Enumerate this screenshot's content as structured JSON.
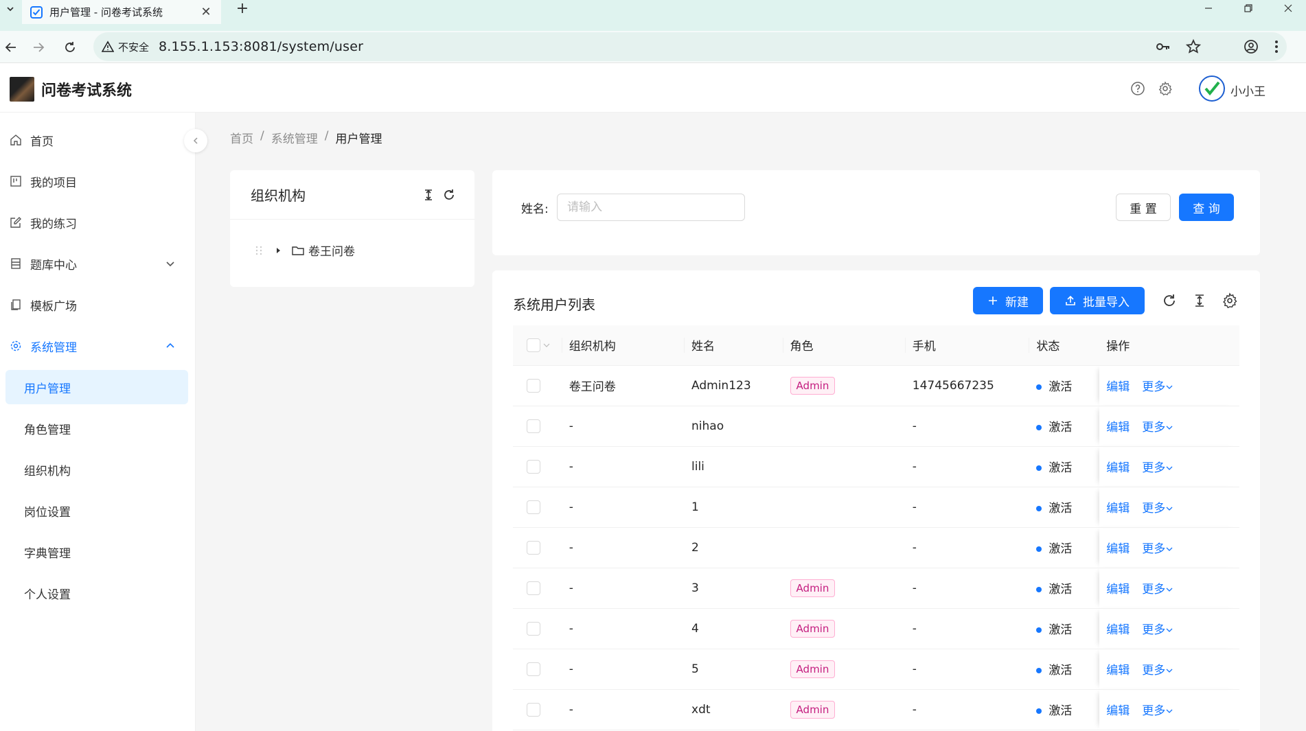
{
  "browser": {
    "tab_title": "用户管理 - 问卷考试系统",
    "security_label": "不安全",
    "url": "8.155.1.153:8081/system/user"
  },
  "header": {
    "app_title": "问卷考试系统",
    "username": "小小王"
  },
  "sidebar": {
    "items": [
      {
        "label": "首页",
        "icon": "home-icon"
      },
      {
        "label": "我的项目",
        "icon": "project-icon"
      },
      {
        "label": "我的练习",
        "icon": "edit-icon"
      },
      {
        "label": "题库中心",
        "icon": "database-icon"
      },
      {
        "label": "模板广场",
        "icon": "copy-icon"
      },
      {
        "label": "系统管理",
        "icon": "gear-icon"
      }
    ],
    "sub_items": [
      {
        "label": "用户管理"
      },
      {
        "label": "角色管理"
      },
      {
        "label": "组织机构"
      },
      {
        "label": "岗位设置"
      },
      {
        "label": "字典管理"
      },
      {
        "label": "个人设置"
      }
    ]
  },
  "breadcrumb": {
    "home": "首页",
    "sep": "/",
    "parent": "系统管理",
    "current": "用户管理"
  },
  "org_panel": {
    "title": "组织机构",
    "node": "卷王问卷"
  },
  "search": {
    "name_label": "姓名:",
    "name_placeholder": "请输入",
    "reset_label": "重 置",
    "query_label": "查 询"
  },
  "list": {
    "title": "系统用户列表",
    "new_label": "新建",
    "import_label": "批量导入",
    "columns": [
      "组织机构",
      "姓名",
      "角色",
      "手机",
      "状态",
      "操作"
    ],
    "edit_label": "编辑",
    "more_label": "更多",
    "rows": [
      {
        "org": "卷王问卷",
        "name": "Admin123",
        "role": "Admin",
        "phone": "14745667235",
        "status": "激活"
      },
      {
        "org": "-",
        "name": "nihao",
        "role": "",
        "phone": "-",
        "status": "激活"
      },
      {
        "org": "-",
        "name": "lili",
        "role": "",
        "phone": "-",
        "status": "激活"
      },
      {
        "org": "-",
        "name": "1",
        "role": "",
        "phone": "-",
        "status": "激活"
      },
      {
        "org": "-",
        "name": "2",
        "role": "",
        "phone": "-",
        "status": "激活"
      },
      {
        "org": "-",
        "name": "3",
        "role": "Admin",
        "phone": "-",
        "status": "激活"
      },
      {
        "org": "-",
        "name": "4",
        "role": "Admin",
        "phone": "-",
        "status": "激活"
      },
      {
        "org": "-",
        "name": "5",
        "role": "Admin",
        "phone": "-",
        "status": "激活"
      },
      {
        "org": "-",
        "name": "xdt",
        "role": "Admin",
        "phone": "-",
        "status": "激活"
      }
    ]
  },
  "colors": {
    "primary": "#1677ff",
    "tag_text": "#c41d7f",
    "tag_bg": "#fff0f6"
  }
}
